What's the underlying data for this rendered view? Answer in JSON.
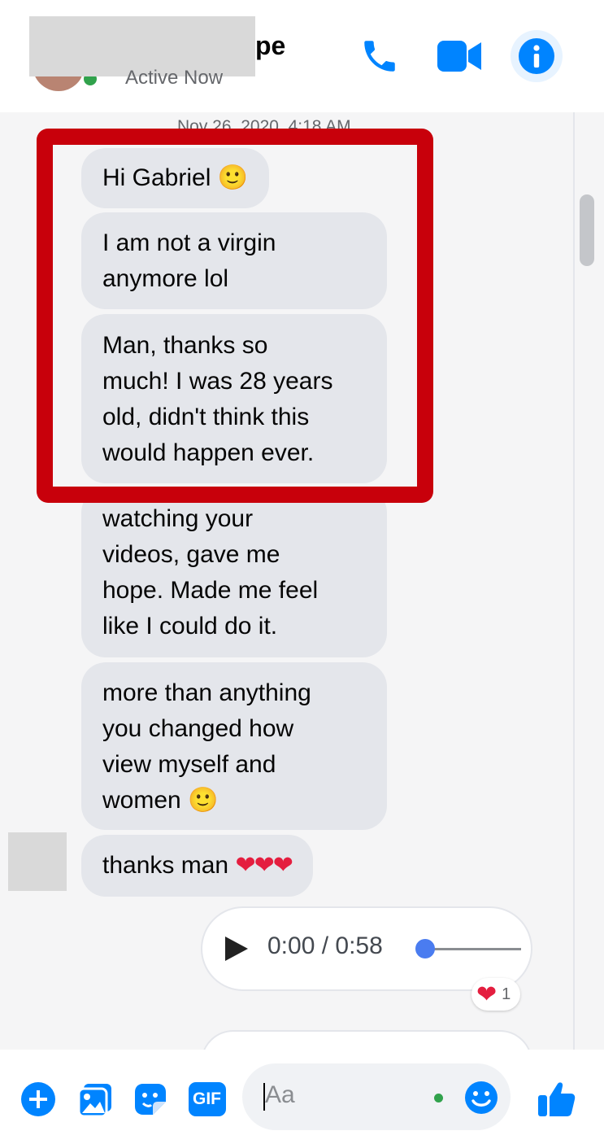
{
  "header": {
    "name_visible": "pe",
    "status": "Active Now",
    "icons": [
      "phone-icon",
      "video-camera-icon",
      "info-icon"
    ]
  },
  "chat": {
    "timestamp": "Nov 26, 2020, 4:18 AM",
    "messages": [
      {
        "text": "Hi Gabriel",
        "emoji": "🙂"
      },
      {
        "line1": "I am not a virgin",
        "line2": "anymore lol"
      },
      {
        "line1": "Man, thanks so",
        "line2": "much! I was 28 years",
        "line3": "old, didn't think this",
        "line4": "would happen ever."
      },
      {
        "line1": "watching your",
        "line2": "videos, gave me",
        "line3": "hope. Made me feel",
        "line4": "like I could do it."
      },
      {
        "line1": "more than anything",
        "line2": "you changed how",
        "line3": "view myself and",
        "line4": "women",
        "emoji": "🙂"
      },
      {
        "text": "thanks man",
        "hearts": "❤❤❤"
      }
    ],
    "audio": {
      "time": "0:00 / 0:58",
      "progress": 0
    },
    "reaction": {
      "emoji": "❤",
      "count": "1"
    }
  },
  "composer": {
    "placeholder": "Aa",
    "icons": [
      "plus-icon",
      "photo-icon",
      "sticker-icon",
      "gif-icon",
      "emoji-icon",
      "thumbs-up-icon"
    ],
    "gif_label": "GIF"
  },
  "colors": {
    "accent": "#0084ff",
    "bubble_bg": "#e4e6eb",
    "highlight": "#c8000b",
    "online": "#31a24c"
  }
}
